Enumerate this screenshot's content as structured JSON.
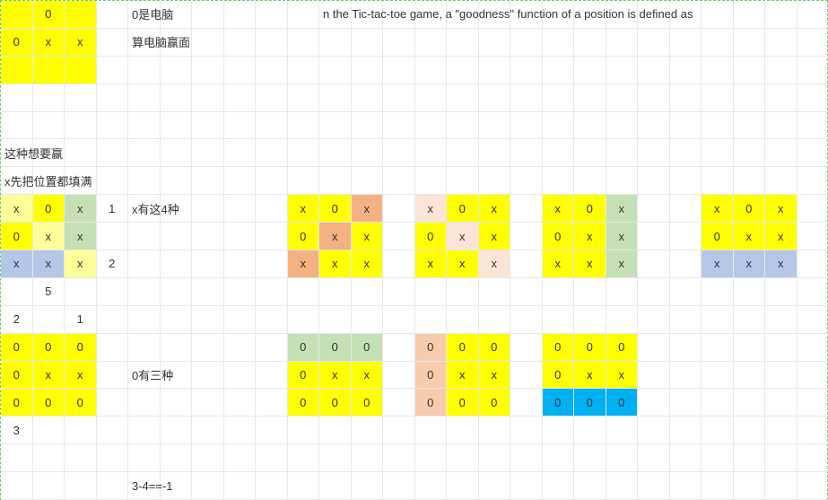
{
  "labels": {
    "zeroIsComputer": "0是电脑",
    "calcComputerWin": "算电脑赢面",
    "wantToWin": "这种想要赢",
    "xFillAll": "x先把位置都填满",
    "xHasFour": "x有这4种",
    "zeroHasThree": "0有三种",
    "formula": "3-4==-1",
    "longText": "n the Tic-tac-toe game, a \"goodness\" function of a position is defined as"
  },
  "tokens": {
    "x": "x",
    "o": "0"
  },
  "nums": {
    "n1": "1",
    "n2": "2",
    "n3": "3",
    "n5": "5"
  },
  "boards": {
    "top": [
      [
        "",
        "0",
        ""
      ],
      [
        "0",
        "x",
        "x"
      ]
    ],
    "b1": [
      [
        "x",
        "0",
        "x"
      ],
      [
        "0",
        "x",
        "x"
      ],
      [
        "x",
        "x",
        "x"
      ]
    ],
    "b1side": [
      "1",
      "",
      "2"
    ],
    "b2": [
      [
        "x",
        "0",
        "x"
      ],
      [
        "0",
        "x",
        "x"
      ],
      [
        "x",
        "x",
        "x"
      ]
    ],
    "b3": [
      [
        "x",
        "0",
        "x"
      ],
      [
        "0",
        "x",
        "x"
      ],
      [
        "x",
        "x",
        "x"
      ]
    ],
    "b4": [
      [
        "x",
        "0",
        "x"
      ],
      [
        "0",
        "x",
        "x"
      ],
      [
        "x",
        "x",
        "x"
      ]
    ],
    "b5": [
      [
        "x",
        "0",
        "x"
      ],
      [
        "0",
        "x",
        "x"
      ],
      [
        "x",
        "x",
        "x"
      ]
    ],
    "row21": [
      "2",
      "",
      "1"
    ],
    "c1": [
      [
        "0",
        "0",
        "0"
      ],
      [
        "0",
        "x",
        "x"
      ],
      [
        "0",
        "0",
        "0"
      ]
    ],
    "c2": [
      [
        "0",
        "0",
        "0"
      ],
      [
        "0",
        "x",
        "x"
      ],
      [
        "0",
        "0",
        "0"
      ]
    ],
    "c3": [
      [
        "0",
        "0",
        "0"
      ],
      [
        "0",
        "x",
        "x"
      ],
      [
        "0",
        "0",
        "0"
      ]
    ],
    "c4": [
      [
        "0",
        "0",
        "0"
      ],
      [
        "0",
        "x",
        "x"
      ],
      [
        "0",
        "0",
        "0"
      ]
    ]
  }
}
